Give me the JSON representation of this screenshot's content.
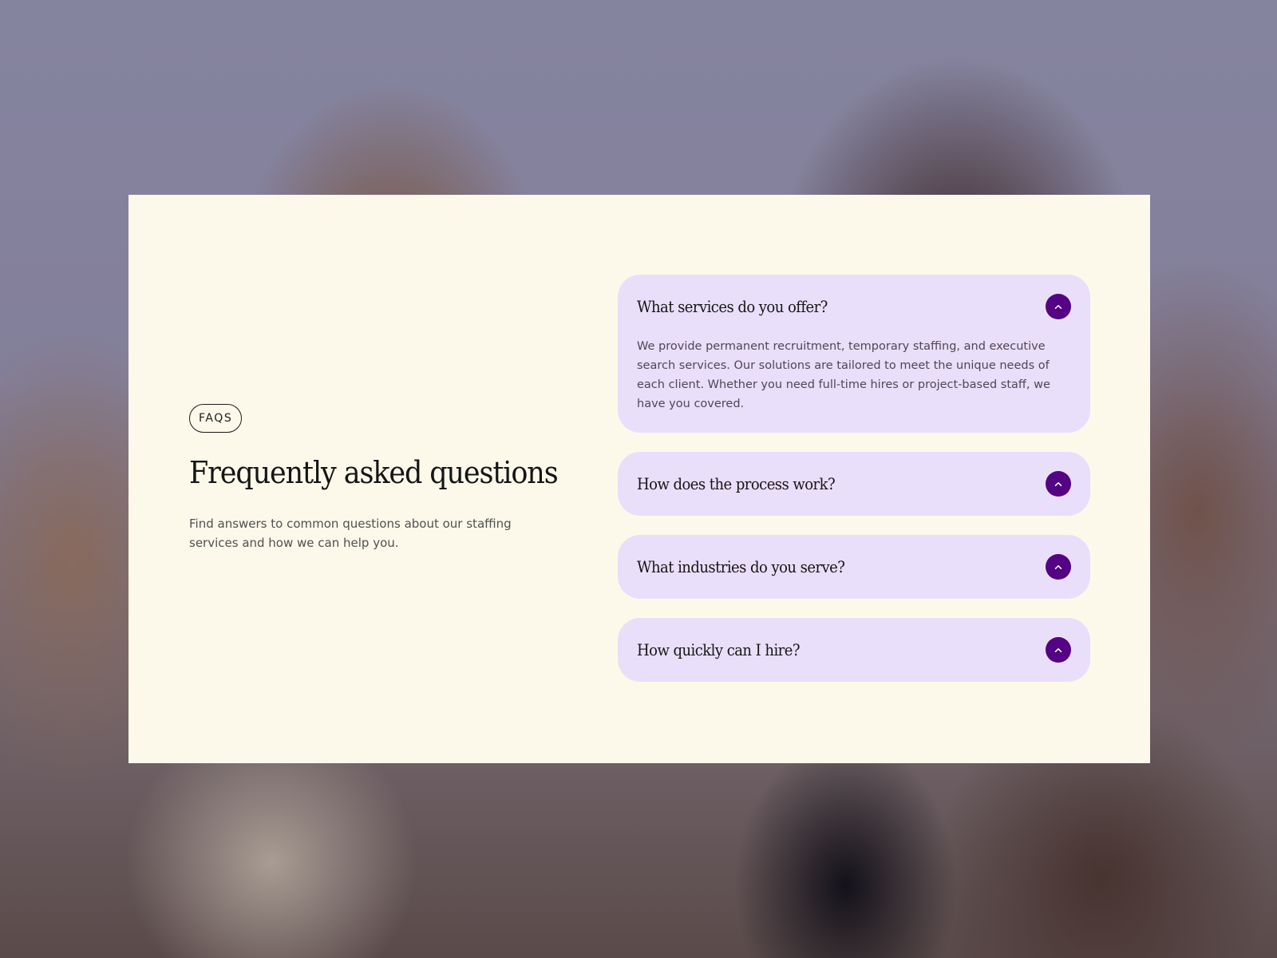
{
  "intro": {
    "badge": "FAQS",
    "title": "Frequently asked questions",
    "description": "Find answers to common questions about our staffing services and how we can help you."
  },
  "faqs": [
    {
      "question": "What services do you offer?",
      "answer": "We provide permanent recruitment, temporary staffing, and executive search services. Our solutions are tailored to meet the unique needs of each client. Whether you need full-time hires or project-based staff, we have you covered.",
      "expanded": true
    },
    {
      "question": "How does the process work?",
      "expanded": false
    },
    {
      "question": "What industries do you serve?",
      "expanded": false
    },
    {
      "question": "How quickly can I hire?",
      "expanded": false
    }
  ],
  "icons": {
    "toggle": "chevron-up-icon"
  },
  "colors": {
    "panel_background": "#fcf9eb",
    "card_background": "#e9dffa",
    "accent": "#540384",
    "heading_text": "#151515",
    "body_text": "#505050"
  }
}
